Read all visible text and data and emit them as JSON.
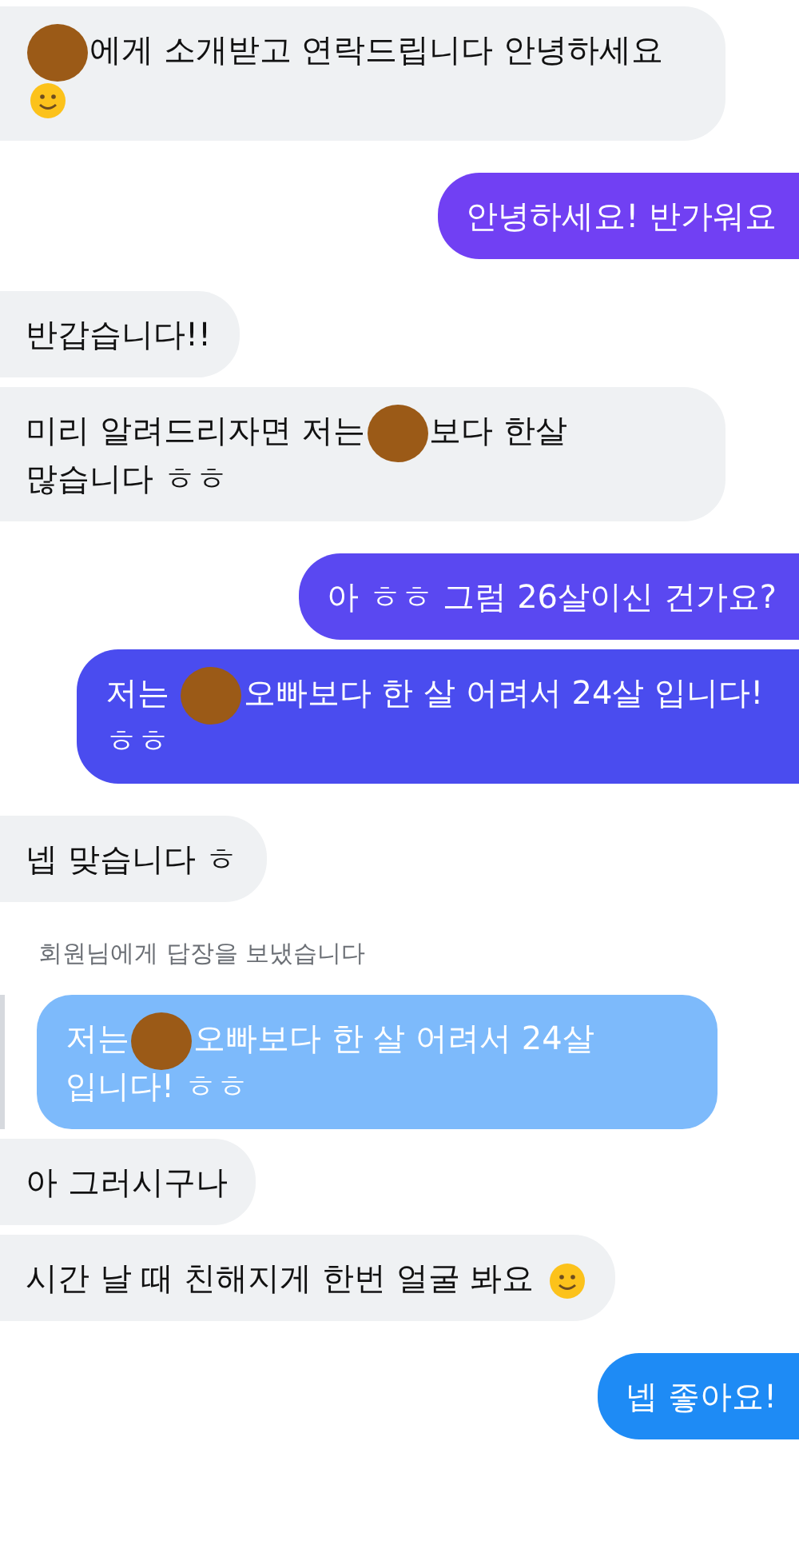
{
  "messages": [
    {
      "kind": "incoming",
      "segments": [
        {
          "kind": "redaction"
        },
        {
          "kind": "text",
          "text": "에게 소개받고 연락드립니다 안녕하세요"
        },
        {
          "kind": "smiley"
        }
      ]
    },
    {
      "kind": "outgoing",
      "color": "#7140f3",
      "segments": [
        {
          "kind": "text",
          "text": "안녕하세요! 반가워요"
        }
      ]
    },
    {
      "kind": "incoming",
      "segments": [
        {
          "kind": "text",
          "text": "반갑습니다!!"
        }
      ]
    },
    {
      "kind": "incoming",
      "segments": [
        {
          "kind": "text",
          "text": "미리 알려드리자면 저는"
        },
        {
          "kind": "redaction"
        },
        {
          "kind": "text",
          "text": "보다 한살 많습니다 ㅎㅎ"
        }
      ]
    },
    {
      "kind": "outgoing",
      "color": "#5a48f1",
      "segments": [
        {
          "kind": "text",
          "text": "아 ㅎㅎ 그럼 26살이신 건가요?"
        }
      ]
    },
    {
      "kind": "outgoing",
      "color": "#4a4cef",
      "segments": [
        {
          "kind": "text",
          "text": "저는 "
        },
        {
          "kind": "redaction"
        },
        {
          "kind": "text",
          "text": "오빠보다 한 살 어려서 24살 입니다! ㅎㅎ"
        }
      ]
    },
    {
      "kind": "incoming",
      "segments": [
        {
          "kind": "text",
          "text": "넵 맞습니다 ㅎ"
        }
      ]
    },
    {
      "kind": "reply_note",
      "text": "회원님에게 답장을 보냈습니다"
    },
    {
      "kind": "quote",
      "segments": [
        {
          "kind": "text",
          "text": "저는"
        },
        {
          "kind": "redaction"
        },
        {
          "kind": "text",
          "text": "오빠보다 한 살 어려서 24살 입니다! ㅎㅎ"
        }
      ]
    },
    {
      "kind": "incoming",
      "segments": [
        {
          "kind": "text",
          "text": "아 그러시구나"
        }
      ]
    },
    {
      "kind": "incoming",
      "segments": [
        {
          "kind": "text",
          "text": "시간 날 때 친해지게 한번 얼굴 봐요 "
        },
        {
          "kind": "smiley"
        }
      ]
    },
    {
      "kind": "outgoing",
      "color": "#1e8bf5",
      "segments": [
        {
          "kind": "text",
          "text": "넵 좋아요!"
        }
      ]
    }
  ]
}
